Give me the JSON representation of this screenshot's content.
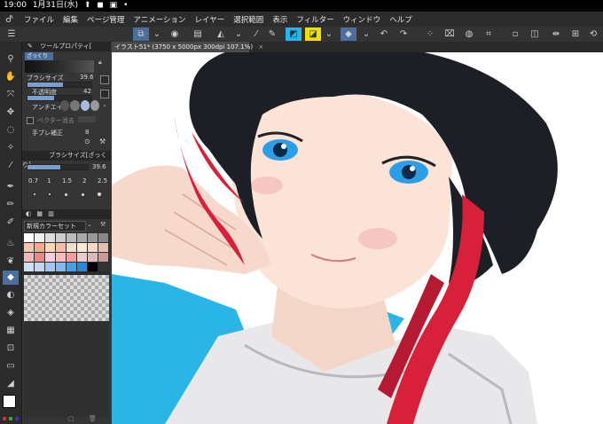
{
  "status_bar": {
    "time": "19:00",
    "date": "1月31日(水)"
  },
  "menu": {
    "items": [
      "ファイル",
      "編集",
      "ページ管理",
      "アニメーション",
      "レイヤー",
      "選択範囲",
      "表示",
      "フィルター",
      "ウィンドウ",
      "ヘルプ"
    ]
  },
  "tool_property": {
    "title": "ツールプロパティ[",
    "preset": "ざっくり",
    "brush_size_label": "ブラシサイズ",
    "brush_size_value": "39.6",
    "opacity_label": "不透明度",
    "opacity_value": "42",
    "antialias_label": "アンチエイリ",
    "vector_label": "ベクター消去",
    "stabilization_label": "手ブレ補正",
    "stabilization_value": "8",
    "brush_size_fill": 0.55,
    "opacity_fill": 0.42
  },
  "brush_size_panel": {
    "title": "ブラシサイズ[ざっくり]",
    "value": "39.6",
    "presets": [
      "0.7",
      "1",
      "1.5",
      "2",
      "2.5"
    ]
  },
  "color_set": {
    "name": "新規カラーセット"
  },
  "canvas": {
    "tab_title": "イラスト51* (3750 x 5000px 300dpi 107.1%)"
  },
  "colors": {
    "accent": "#4d6d9a",
    "cyan": "#29b6e6",
    "hair": "#1d1f26",
    "red": "#d8203a"
  }
}
